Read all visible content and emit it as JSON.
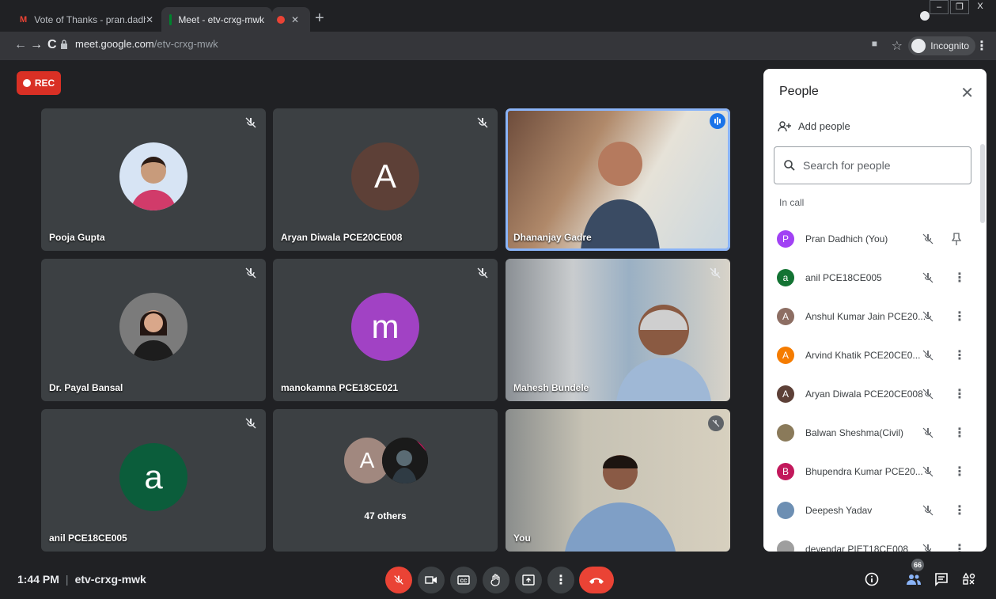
{
  "browser": {
    "tabs": [
      {
        "title": "Vote of Thanks - pran.dadhich@|"
      },
      {
        "title": "Meet - etv-crxg-mwk"
      }
    ],
    "url_host": "meet.google.com",
    "url_path": "/etv-crxg-mwk",
    "incognito_label": "Incognito"
  },
  "meet": {
    "rec_label": "REC",
    "tiles": [
      {
        "name": "Pooja Gupta"
      },
      {
        "name": "Aryan Diwala PCE20CE008",
        "initial": "A"
      },
      {
        "name": "Dhananjay Gadre"
      },
      {
        "name": "Dr. Payal Bansal"
      },
      {
        "name": "manokamna PCE18CE021",
        "initial": "m"
      },
      {
        "name": "Mahesh Bundele"
      },
      {
        "name": "anil PCE18CE005",
        "initial": "a"
      },
      {
        "others_label": "47 others",
        "initial": "A"
      },
      {
        "name": "You"
      }
    ],
    "colors": {
      "accent": "#1a73e8",
      "leave": "#ea4335",
      "tile": "#3c4043"
    }
  },
  "people": {
    "title": "People",
    "add_people": "Add people",
    "search_placeholder": "Search for people",
    "section": "In call",
    "participants": [
      {
        "name": "Pran Dadhich (You)",
        "initial": "P",
        "color": "#a142f4"
      },
      {
        "name": "anil PCE18CE005",
        "initial": "a",
        "color": "#137333"
      },
      {
        "name": "Anshul Kumar Jain PCE20...",
        "initial": "A",
        "color": "#8d6e63"
      },
      {
        "name": "Arvind Khatik PCE20CE0...",
        "initial": "A",
        "color": "#f57c00"
      },
      {
        "name": "Aryan Diwala PCE20CE008",
        "initial": "A",
        "color": "#5d4037"
      },
      {
        "name": "Balwan Sheshma(Civil)",
        "initial": "",
        "color": "#8a7a5a"
      },
      {
        "name": "Bhupendra Kumar PCE20...",
        "initial": "B",
        "color": "#c2185b"
      },
      {
        "name": "Deepesh Yadav",
        "initial": "",
        "color": "#6d8fb3"
      },
      {
        "name": "devendar PIET18CE008",
        "initial": "",
        "color": "#9e9e9e"
      }
    ]
  },
  "bottom": {
    "time": "1:44 PM",
    "meeting_code": "etv-crxg-mwk",
    "people_count": "66"
  }
}
